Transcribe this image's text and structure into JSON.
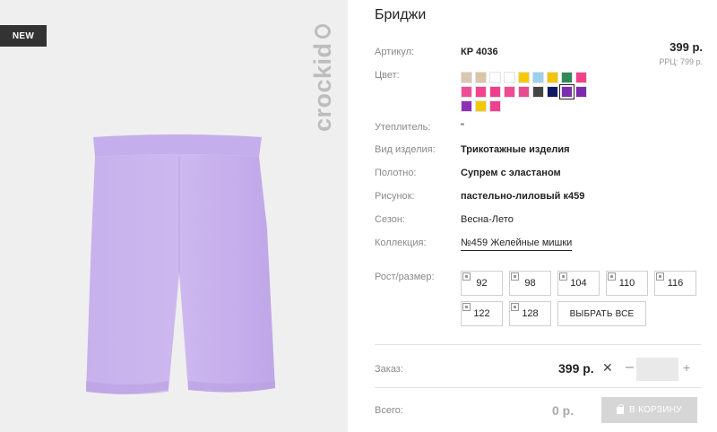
{
  "badge": "NEW",
  "brand": "crockid",
  "product": {
    "title": "Бриджи",
    "sku_label": "Артикул:",
    "sku_value": "КР 4036",
    "price": "399 р.",
    "rrc": "РРЦ: 799 р.",
    "color_label": "Цвет:",
    "colors": [
      "#d9c8b0",
      "#d8c6a7",
      "#ffffff",
      "#ffffff",
      "#f7c900",
      "#9ad1ee",
      "#f2c500",
      "#2e8b57",
      "#f0418a",
      "#f04f98",
      "#f4428e",
      "#ee3f8c",
      "#f14892",
      "#e94b8f",
      "#444444",
      "#0e1a63",
      "#7b2fb0",
      "#7a2bb0",
      "#8e2fb5",
      "#f1c900",
      "#ef3f8d"
    ],
    "selected_color_index": 16,
    "attributes": [
      {
        "label": "Утеплитель:",
        "value": "\"",
        "bold": false
      },
      {
        "label": "Вид изделия:",
        "value": "Трикотажные изделия",
        "bold": true
      },
      {
        "label": "Полотно:",
        "value": "Супрем с эластаном",
        "bold": true
      },
      {
        "label": "Рисунок:",
        "value": "пастельно-лиловый к459",
        "bold": true
      },
      {
        "label": "Сезон:",
        "value": "Весна-Лето",
        "bold": false
      },
      {
        "label": "Коллекция:",
        "value": "№459 Желейные мишки",
        "bold": false
      }
    ],
    "size_label": "Рост/размер:",
    "sizes": [
      "92",
      "98",
      "104",
      "110",
      "116",
      "122",
      "128"
    ],
    "select_all": "ВЫБРАТЬ ВСЕ",
    "order_label": "Заказ:",
    "order_price": "399 р.",
    "times_symbol": "✕",
    "minus_symbol": "–",
    "plus_symbol": "+",
    "total_label": "Всего:",
    "total_price": "0 р.",
    "cart_button": "В КОРЗИНУ"
  }
}
